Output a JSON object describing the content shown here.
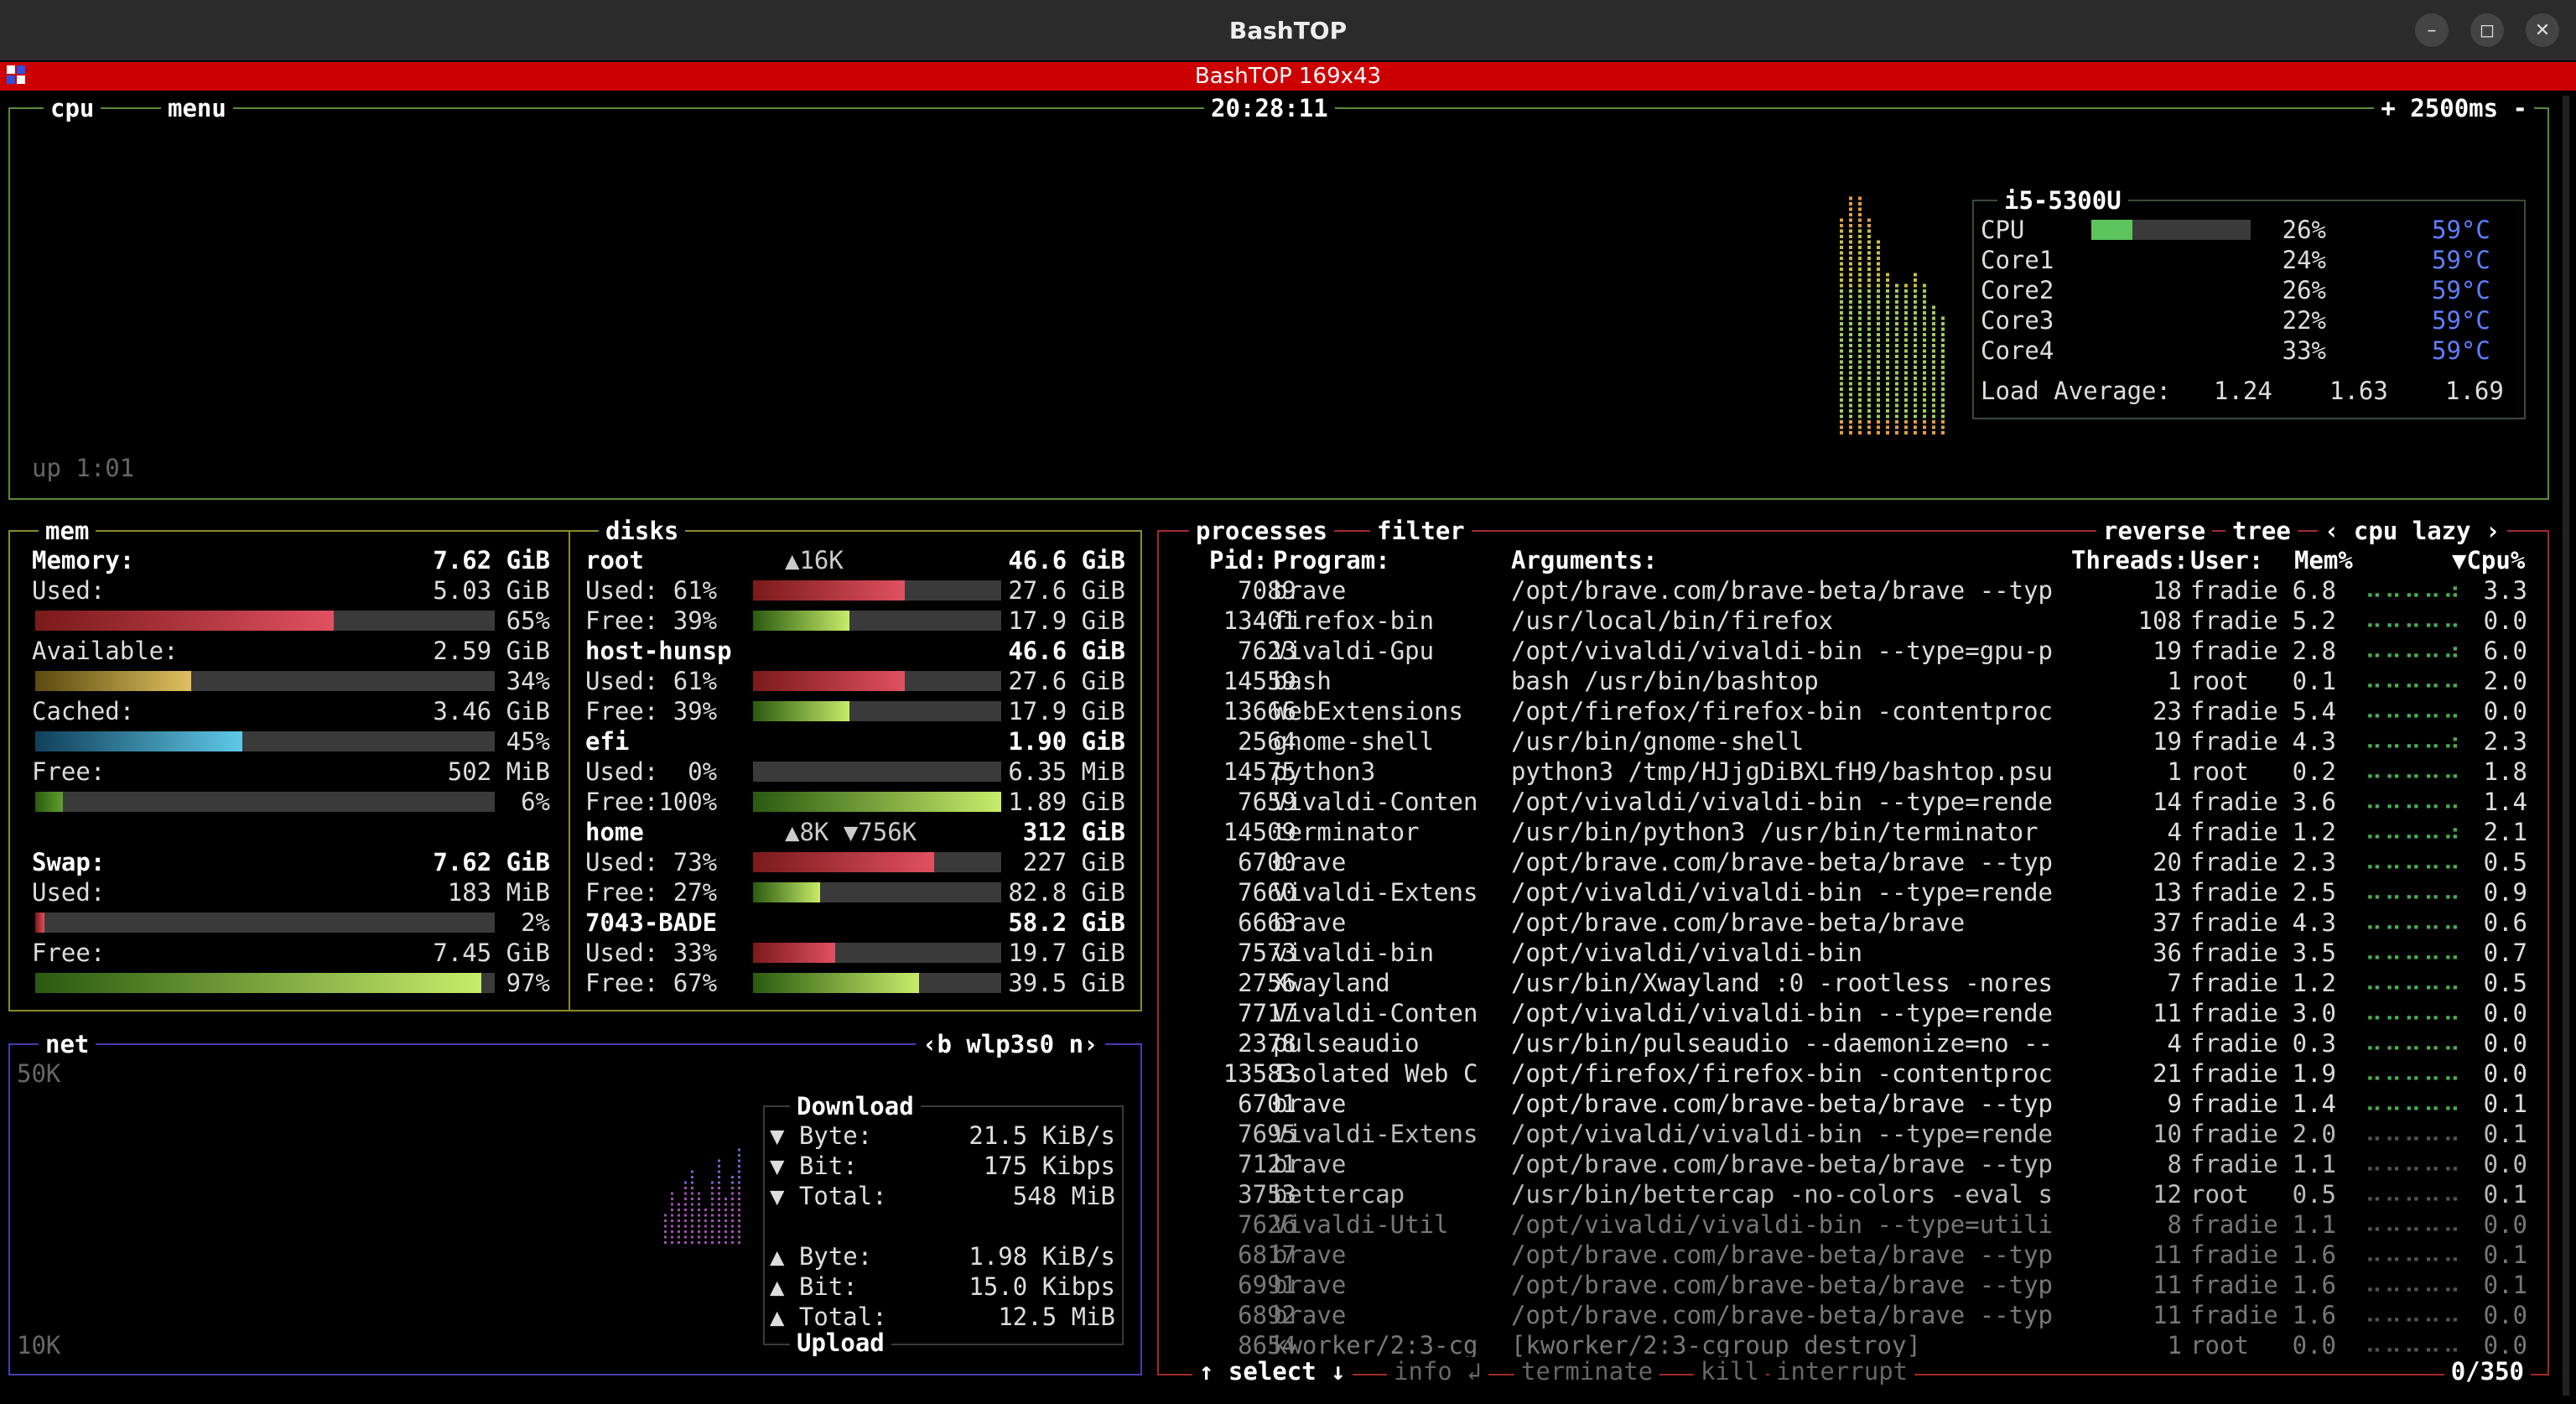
{
  "window": {
    "title": "BashTOP",
    "btn_min": "–",
    "btn_max": "◻",
    "btn_close": "✕"
  },
  "terminal": {
    "title": "BashTOP 169x43"
  },
  "colors": {
    "cpu_border": "#5a8a3a",
    "mem_border": "#8a8a2a",
    "net_border": "#4a3ab0",
    "proc_border": "#a02a2a",
    "accent_red": "#cc0000",
    "temp_blue": "#5f7fff"
  },
  "cpu_box": {
    "tab_cpu": "cpu",
    "tab_menu": "menu",
    "clock": "20:28:11",
    "interval": "+ 2500ms -",
    "uptime": "up 1:01",
    "model": "i5-5300U",
    "rows": [
      {
        "label": "CPU",
        "pct": "26%",
        "temp": "59°C",
        "level": 0.26
      },
      {
        "label": "Core1",
        "pct": "24%",
        "temp": "59°C",
        "level": 0.24
      },
      {
        "label": "Core2",
        "pct": "26%",
        "temp": "59°C",
        "level": 0.26
      },
      {
        "label": "Core3",
        "pct": "22%",
        "temp": "59°C",
        "level": 0.22
      },
      {
        "label": "Core4",
        "pct": "33%",
        "temp": "59°C",
        "level": 0.33
      }
    ],
    "load_label": "Load Average:",
    "load1": "1.24",
    "load5": "1.63",
    "load15": "1.69"
  },
  "mem_box": {
    "tab": "mem",
    "memory_label": "Memory:",
    "memory_total": "7.62 GiB",
    "used_label": "Used:",
    "used_val": "5.03 GiB",
    "used_pct": "65%",
    "used_level": 0.65,
    "avail_label": "Available:",
    "avail_val": "2.59 GiB",
    "avail_pct": "34%",
    "avail_level": 0.34,
    "cached_label": "Cached:",
    "cached_val": "3.46 GiB",
    "cached_pct": "45%",
    "cached_level": 0.45,
    "free_label": "Free:",
    "free_val": "502 MiB",
    "free_pct": "6%",
    "free_level": 0.06,
    "swap_label": "Swap:",
    "swap_total": "7.62 GiB",
    "swap_used_label": "Used:",
    "swap_used_val": "183 MiB",
    "swap_used_pct": "2%",
    "swap_used_level": 0.02,
    "swap_free_label": "Free:",
    "swap_free_val": "7.45 GiB",
    "swap_free_pct": "97%",
    "swap_free_level": 0.97
  },
  "disks_box": {
    "tab": "disks",
    "disks": [
      {
        "name": "root",
        "io": "▲16K",
        "total": "46.6 GiB",
        "used_label": "Used: 61%",
        "used_val": "27.6 GiB",
        "used_level": 0.61,
        "free_label": "Free: 39%",
        "free_val": "17.9 GiB",
        "free_level": 0.39
      },
      {
        "name": "host-hunsp",
        "io": "",
        "total": "46.6 GiB",
        "used_label": "Used: 61%",
        "used_val": "27.6 GiB",
        "used_level": 0.61,
        "free_label": "Free: 39%",
        "free_val": "17.9 GiB",
        "free_level": 0.39
      },
      {
        "name": "efi",
        "io": "",
        "total": "1.90 GiB",
        "used_label": "Used:  0%",
        "used_val": "6.35 MiB",
        "used_level": 0.0,
        "free_label": "Free:100%",
        "free_val": "1.89 GiB",
        "free_level": 1.0
      },
      {
        "name": "home",
        "io": "▲8K ▼756K",
        "total": "312 GiB",
        "used_label": "Used: 73%",
        "used_val": "227 GiB",
        "used_level": 0.73,
        "free_label": "Free: 27%",
        "free_val": "82.8 GiB",
        "free_level": 0.27
      },
      {
        "name": "7043-BADE",
        "io": "",
        "total": "58.2 GiB",
        "used_label": "Used: 33%",
        "used_val": "19.7 GiB",
        "used_level": 0.33,
        "free_label": "Free: 67%",
        "free_val": "39.5 GiB",
        "free_level": 0.67
      }
    ]
  },
  "net_box": {
    "tab": "net",
    "iface": "‹b wlp3s0 n›",
    "scale_top": "50K",
    "scale_bottom": "10K",
    "download_title": "Download",
    "upload_title": "Upload",
    "dl_byte_label": "▼ Byte:",
    "dl_byte": "21.5 KiB/s",
    "dl_bit_label": "▼ Bit:",
    "dl_bit": "175 Kibps",
    "dl_total_label": "▼ Total:",
    "dl_total": "548 MiB",
    "ul_byte_label": "▲ Byte:",
    "ul_byte": "1.98 KiB/s",
    "ul_bit_label": "▲ Bit:",
    "ul_bit": "15.0 Kibps",
    "ul_total_label": "▲ Total:",
    "ul_total": "12.5 MiB"
  },
  "proc_box": {
    "tab_processes": "processes",
    "tab_filter": "filter",
    "tab_reverse": "reverse",
    "tab_tree": "tree",
    "sort": "‹ cpu lazy ›",
    "headers": {
      "pid": "Pid:",
      "program": "Program:",
      "args": "Arguments:",
      "threads": "Threads:",
      "user": "User:",
      "mem": "Mem%",
      "cpu": "▼Cpu%"
    },
    "rows": [
      {
        "pid": "7089",
        "program": "brave",
        "args": "/opt/brave.com/brave-beta/brave --typ",
        "threads": "18",
        "user": "fradie",
        "mem": "6.8",
        "cpu": "3.3"
      },
      {
        "pid": "13401",
        "program": "firefox-bin",
        "args": "/usr/local/bin/firefox",
        "threads": "108",
        "user": "fradie",
        "mem": "5.2",
        "cpu": "0.0"
      },
      {
        "pid": "7623",
        "program": "Vivaldi-Gpu",
        "args": "/opt/vivaldi/vivaldi-bin --type=gpu-p",
        "threads": "19",
        "user": "fradie",
        "mem": "2.8",
        "cpu": "6.0"
      },
      {
        "pid": "14559",
        "program": "bash",
        "args": "bash /usr/bin/bashtop",
        "threads": "1",
        "user": "root",
        "mem": "0.1",
        "cpu": "2.0"
      },
      {
        "pid": "13666",
        "program": "WebExtensions",
        "args": "/opt/firefox/firefox-bin -contentproc",
        "threads": "23",
        "user": "fradie",
        "mem": "5.4",
        "cpu": "0.0"
      },
      {
        "pid": "2564",
        "program": "gnome-shell",
        "args": "/usr/bin/gnome-shell",
        "threads": "19",
        "user": "fradie",
        "mem": "4.3",
        "cpu": "2.3"
      },
      {
        "pid": "14575",
        "program": "python3",
        "args": "python3 /tmp/HJjgDiBXLfH9/bashtop.psu",
        "threads": "1",
        "user": "root",
        "mem": "0.2",
        "cpu": "1.8"
      },
      {
        "pid": "7659",
        "program": "Vivaldi-Conten",
        "args": "/opt/vivaldi/vivaldi-bin --type=rende",
        "threads": "14",
        "user": "fradie",
        "mem": "3.6",
        "cpu": "1.4"
      },
      {
        "pid": "14509",
        "program": "terminator",
        "args": "/usr/bin/python3 /usr/bin/terminator",
        "threads": "4",
        "user": "fradie",
        "mem": "1.2",
        "cpu": "2.1"
      },
      {
        "pid": "6700",
        "program": "brave",
        "args": "/opt/brave.com/brave-beta/brave --typ",
        "threads": "20",
        "user": "fradie",
        "mem": "2.3",
        "cpu": "0.5"
      },
      {
        "pid": "7660",
        "program": "Vivaldi-Extens",
        "args": "/opt/vivaldi/vivaldi-bin --type=rende",
        "threads": "13",
        "user": "fradie",
        "mem": "2.5",
        "cpu": "0.9"
      },
      {
        "pid": "6663",
        "program": "brave",
        "args": "/opt/brave.com/brave-beta/brave",
        "threads": "37",
        "user": "fradie",
        "mem": "4.3",
        "cpu": "0.6"
      },
      {
        "pid": "7573",
        "program": "vivaldi-bin",
        "args": "/opt/vivaldi/vivaldi-bin",
        "threads": "36",
        "user": "fradie",
        "mem": "3.5",
        "cpu": "0.7"
      },
      {
        "pid": "2756",
        "program": "Xwayland",
        "args": "/usr/bin/Xwayland :0 -rootless -nores",
        "threads": "7",
        "user": "fradie",
        "mem": "1.2",
        "cpu": "0.5"
      },
      {
        "pid": "7717",
        "program": "Vivaldi-Conten",
        "args": "/opt/vivaldi/vivaldi-bin --type=rende",
        "threads": "11",
        "user": "fradie",
        "mem": "3.0",
        "cpu": "0.0"
      },
      {
        "pid": "2378",
        "program": "pulseaudio",
        "args": "/usr/bin/pulseaudio --daemonize=no --",
        "threads": "4",
        "user": "fradie",
        "mem": "0.3",
        "cpu": "0.0"
      },
      {
        "pid": "13583",
        "program": "Isolated Web C",
        "args": "/opt/firefox/firefox-bin -contentproc",
        "threads": "21",
        "user": "fradie",
        "mem": "1.9",
        "cpu": "0.0"
      },
      {
        "pid": "6701",
        "program": "brave",
        "args": "/opt/brave.com/brave-beta/brave --typ",
        "threads": "9",
        "user": "fradie",
        "mem": "1.4",
        "cpu": "0.1"
      },
      {
        "pid": "7695",
        "program": "Vivaldi-Extens",
        "args": "/opt/vivaldi/vivaldi-bin --type=rende",
        "threads": "10",
        "user": "fradie",
        "mem": "2.0",
        "cpu": "0.1"
      },
      {
        "pid": "7121",
        "program": "brave",
        "args": "/opt/brave.com/brave-beta/brave --typ",
        "threads": "8",
        "user": "fradie",
        "mem": "1.1",
        "cpu": "0.0"
      },
      {
        "pid": "3753",
        "program": "bettercap",
        "args": "/usr/bin/bettercap -no-colors -eval s",
        "threads": "12",
        "user": "root",
        "mem": "0.5",
        "cpu": "0.1"
      },
      {
        "pid": "7626",
        "program": "Vivaldi-Util",
        "args": "/opt/vivaldi/vivaldi-bin --type=utili",
        "threads": "8",
        "user": "fradie",
        "mem": "1.1",
        "cpu": "0.0"
      },
      {
        "pid": "6817",
        "program": "brave",
        "args": "/opt/brave.com/brave-beta/brave --typ",
        "threads": "11",
        "user": "fradie",
        "mem": "1.6",
        "cpu": "0.1"
      },
      {
        "pid": "6991",
        "program": "brave",
        "args": "/opt/brave.com/brave-beta/brave --typ",
        "threads": "11",
        "user": "fradie",
        "mem": "1.6",
        "cpu": "0.1"
      },
      {
        "pid": "6892",
        "program": "brave",
        "args": "/opt/brave.com/brave-beta/brave --typ",
        "threads": "11",
        "user": "fradie",
        "mem": "1.6",
        "cpu": "0.0"
      },
      {
        "pid": "8654",
        "program": "kworker/2:3-cg",
        "args": "[kworker/2:3-cgroup_destroy]",
        "threads": "1",
        "user": "root",
        "mem": "0.0",
        "cpu": "0.0"
      }
    ],
    "footer_select": "↑ select ↓",
    "footer_info": "info ↲",
    "footer_terminate": "terminate",
    "footer_kill": "kill",
    "footer_interrupt": "interrupt",
    "count": "0/350"
  }
}
